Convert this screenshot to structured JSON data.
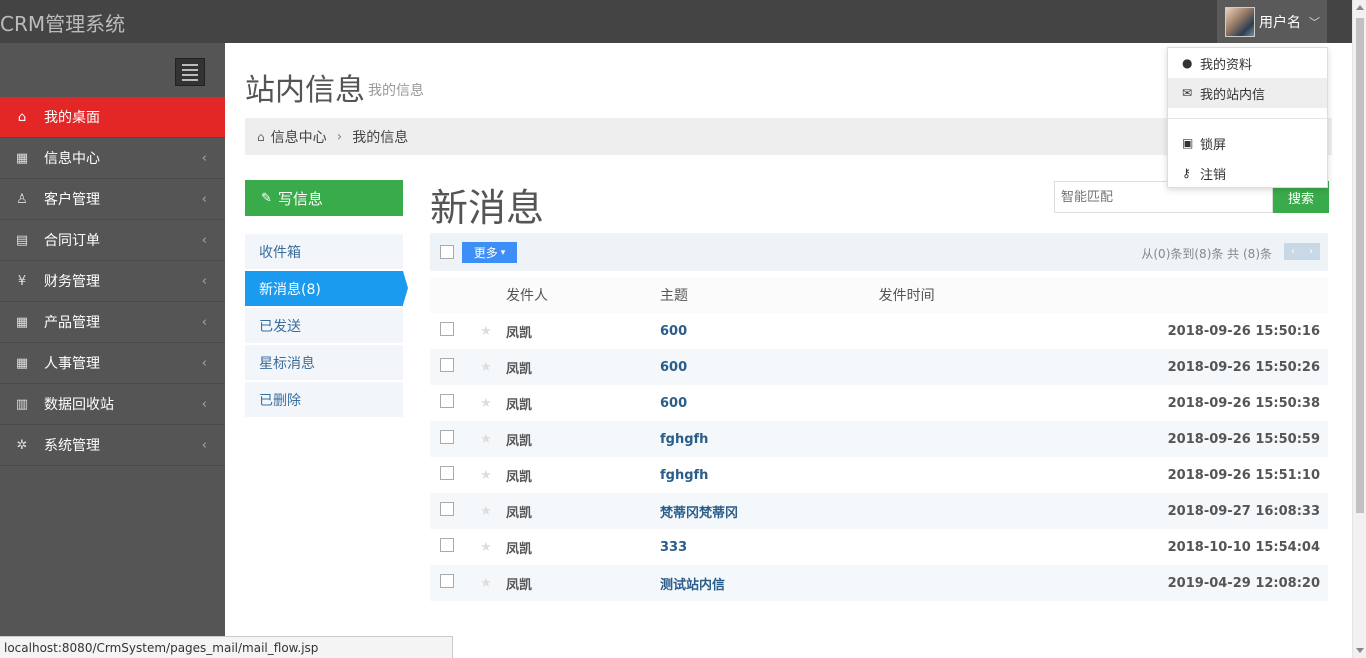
{
  "app": {
    "title": "CRM管理系统"
  },
  "user": {
    "name": "用户名"
  },
  "sidebar": {
    "items": [
      {
        "label": "我的桌面",
        "icon": "home-icon",
        "glyph": "⌂",
        "active": true
      },
      {
        "label": "信息中心",
        "icon": "calendar-icon",
        "glyph": "▦",
        "active": false
      },
      {
        "label": "客户管理",
        "icon": "person-icon",
        "glyph": "♙",
        "active": false
      },
      {
        "label": "合同订单",
        "icon": "book-icon",
        "glyph": "▤",
        "active": false
      },
      {
        "label": "财务管理",
        "icon": "yen-icon",
        "glyph": "¥",
        "active": false
      },
      {
        "label": "产品管理",
        "icon": "table-icon",
        "glyph": "▦",
        "active": false
      },
      {
        "label": "人事管理",
        "icon": "table-icon",
        "glyph": "▦",
        "active": false
      },
      {
        "label": "数据回收站",
        "icon": "trash-icon",
        "glyph": "▥",
        "active": false
      },
      {
        "label": "系统管理",
        "icon": "gear-icon",
        "glyph": "✲",
        "active": false
      }
    ]
  },
  "page": {
    "title": "站内信息",
    "subtitle": "我的信息"
  },
  "breadcrumb": {
    "home": "信息中心",
    "current": "我的信息"
  },
  "compose": {
    "label": "写信息"
  },
  "folders": [
    {
      "label": "收件箱",
      "active": false
    },
    {
      "label": "新消息(8)",
      "active": true
    },
    {
      "label": "已发送",
      "active": false
    },
    {
      "label": "星标消息",
      "active": false
    },
    {
      "label": "已删除",
      "active": false
    }
  ],
  "mailbox": {
    "title": "新消息",
    "search_placeholder": "智能匹配",
    "search_label": "搜索",
    "more_label": "更多",
    "pager_info": "从(0)条到(8)条 共 (8)条",
    "columns": {
      "sender": "发件人",
      "subject": "主题",
      "time": "发件时间"
    },
    "rows": [
      {
        "sender": "凤凯",
        "subject": "600",
        "time": "2018-09-26 15:50:16"
      },
      {
        "sender": "凤凯",
        "subject": "600",
        "time": "2018-09-26 15:50:26"
      },
      {
        "sender": "凤凯",
        "subject": "600",
        "time": "2018-09-26 15:50:38"
      },
      {
        "sender": "凤凯",
        "subject": "fghgfh",
        "time": "2018-09-26 15:50:59"
      },
      {
        "sender": "凤凯",
        "subject": "fghgfh",
        "time": "2018-09-26 15:51:10"
      },
      {
        "sender": "凤凯",
        "subject": "梵蒂冈梵蒂冈",
        "time": "2018-09-27 16:08:33"
      },
      {
        "sender": "凤凯",
        "subject": "333",
        "time": "2018-10-10 15:54:04"
      },
      {
        "sender": "凤凯",
        "subject": "测试站内信",
        "time": "2019-04-29 12:08:20"
      }
    ]
  },
  "dropdown": {
    "items": [
      {
        "label": "我的资料",
        "icon": "user-icon",
        "glyph": "👤"
      },
      {
        "label": "我的站内信",
        "icon": "envelope-icon",
        "glyph": "✉"
      },
      {
        "label": "锁屏",
        "icon": "lock-icon",
        "glyph": "🔒"
      },
      {
        "label": "注销",
        "icon": "key-icon",
        "glyph": "⚷"
      }
    ]
  },
  "statusbar": {
    "url": "localhost:8080/CrmSystem/pages_mail/mail_flow.jsp"
  },
  "colors": {
    "accent_red": "#e32626",
    "accent_green": "#3aab4b",
    "accent_blue": "#1a9bf0",
    "topbar": "#444444",
    "sidebar": "#555555"
  }
}
